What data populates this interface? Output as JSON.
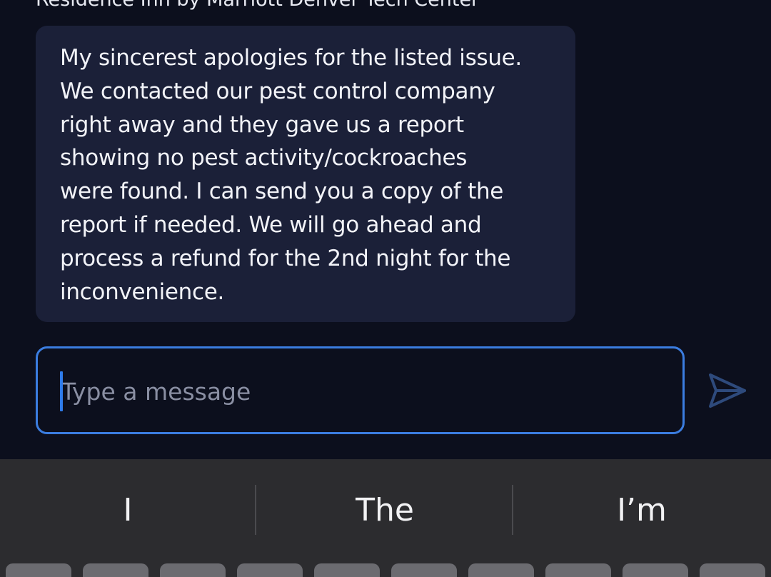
{
  "chat": {
    "sender": "Residence Inn by Marriott Denver Tech Center",
    "message": "My sincerest apologies for the listed issue.\nWe contacted our pest control company\nright away and they gave us a report\nshowing no pest activity/cockroaches\nwere found. I can send you a copy of the\nreport if needed. We will go ahead and\nprocess a refund for the 2nd night for the\ninconvenience."
  },
  "composer": {
    "placeholder": "Type a message",
    "value": ""
  },
  "keyboard": {
    "suggestions": [
      "I",
      "The",
      "I’m"
    ]
  },
  "colors": {
    "background": "#0c0f1d",
    "bubble": "#1b2038",
    "accent": "#3b7de0",
    "send_icon": "#2e4a7c",
    "keyboard": "#2c2c2f"
  },
  "icons": {
    "send": "send-icon"
  }
}
